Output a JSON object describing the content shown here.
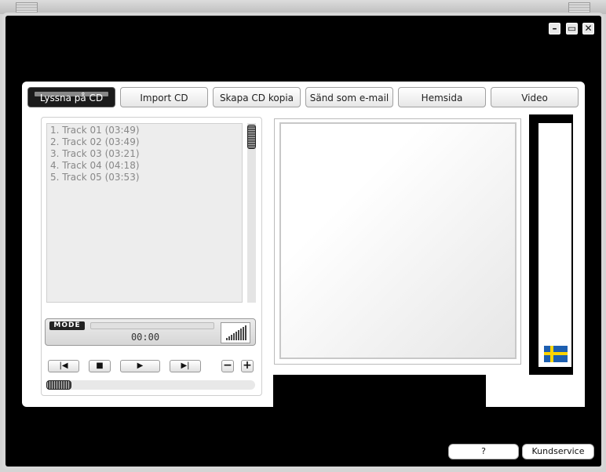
{
  "window": {
    "minimize_label": "–",
    "maximize_label": "▭",
    "close_label": "✕"
  },
  "tabs": [
    {
      "label": "Lyssna på CD",
      "active": true
    },
    {
      "label": "Import CD",
      "active": false
    },
    {
      "label": "Skapa CD kopia",
      "active": false
    },
    {
      "label": "Sänd som e-mail",
      "active": false
    },
    {
      "label": "Hemsida",
      "active": false
    },
    {
      "label": "Video",
      "active": false
    }
  ],
  "playlist": {
    "tracks": [
      "1. Track 01 (03:49)",
      "2. Track 02 (03:49)",
      "3. Track 03 (03:21)",
      "4. Track 04 (04:18)",
      "5. Track 05 (03:53)"
    ]
  },
  "player": {
    "mode_label": "MODE",
    "time": "00:00",
    "controls": {
      "prev": "|◀",
      "stop": "■",
      "play": "▶",
      "next": "▶|",
      "volume_down": "−",
      "volume_up": "+"
    },
    "progress_fraction": 0
  },
  "footer": {
    "help_label": "?",
    "support_label": "Kundservice"
  },
  "language_flag": "sweden-flag-icon",
  "colors": {
    "background": "#000000",
    "panel": "#ffffff",
    "active_tab": "#1b1b1b",
    "flag_blue": "#1d5fb0",
    "flag_yellow": "#ffd400"
  }
}
